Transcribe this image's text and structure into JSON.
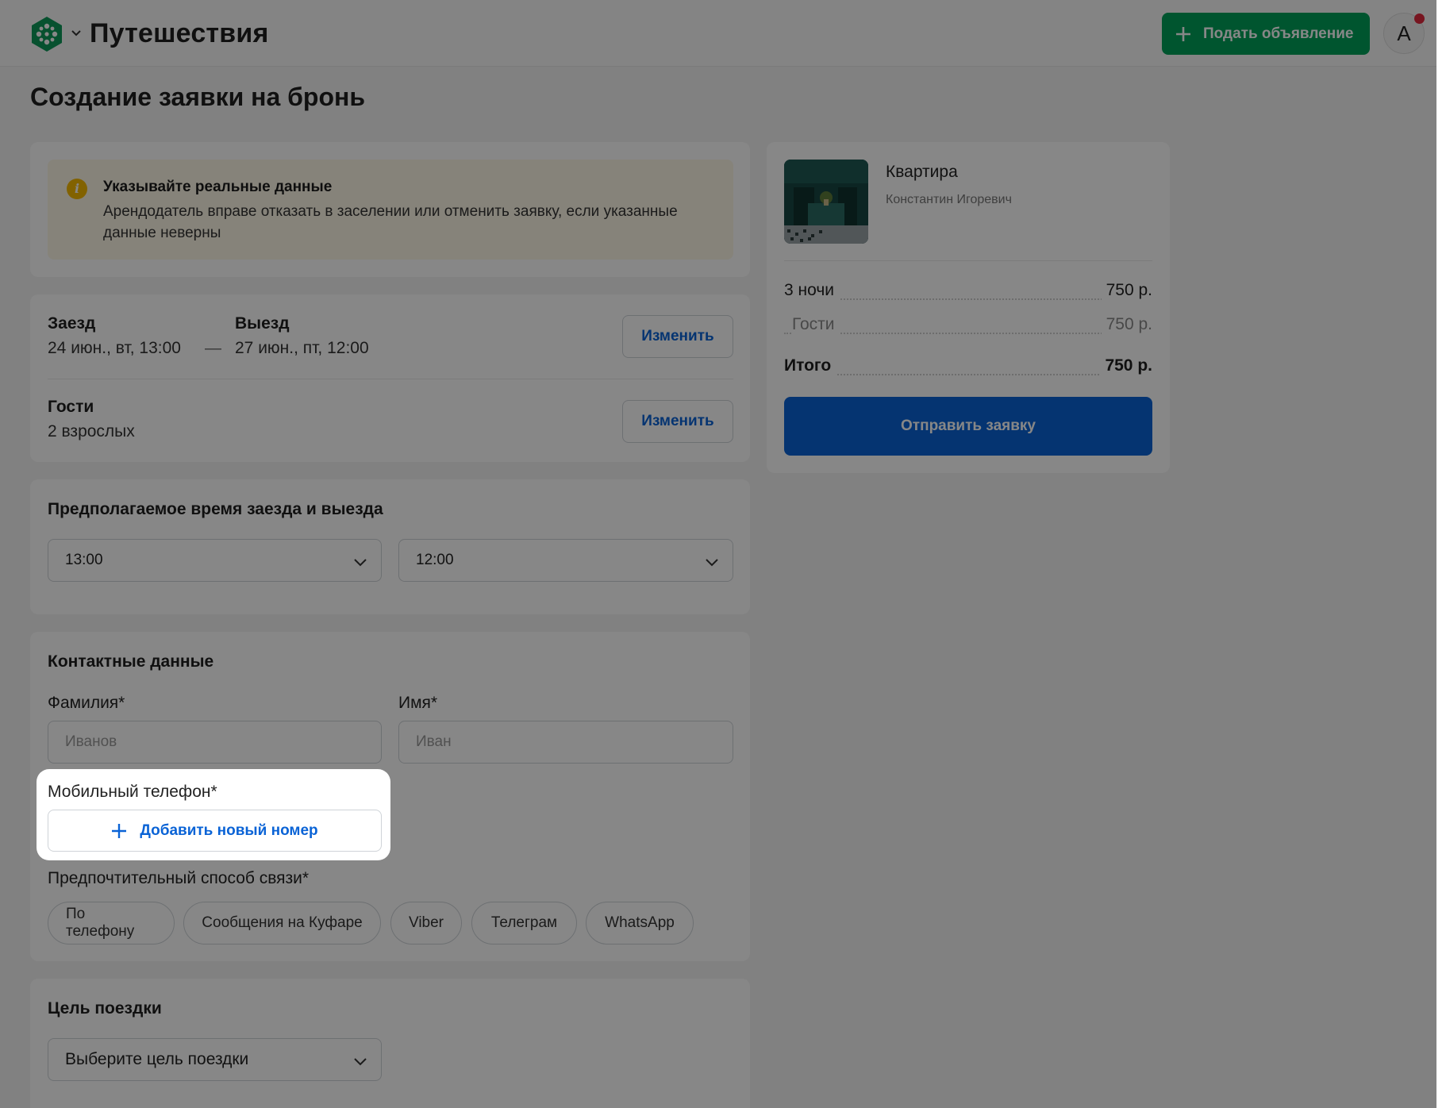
{
  "header": {
    "site_title": "Путешествия",
    "post_button": "Подать объявление",
    "avatar_letter": "А"
  },
  "page_title": "Создание заявки на бронь",
  "notice": {
    "title": "Указывайте реальные данные",
    "text": "Арендодатель вправе отказать в заселении или отменить заявку, если указанные данные неверны"
  },
  "dates": {
    "checkin_label": "Заезд",
    "checkin_value": "24 июн., вт, 13:00",
    "dash": "—",
    "checkout_label": "Выезд",
    "checkout_value": "27 июн., пт, 12:00",
    "change_button": "Изменить"
  },
  "guests": {
    "label": "Гости",
    "value": "2 взрослых",
    "change_button": "Изменить"
  },
  "times": {
    "title": "Предполагаемое время заезда и выезда",
    "checkin_time": "13:00",
    "checkout_time": "12:00"
  },
  "contacts": {
    "title": "Контактные данные",
    "last_name_label": "Фамилия*",
    "last_name_placeholder": "Иванов",
    "first_name_label": "Имя*",
    "first_name_placeholder": "Иван",
    "phone_label": "Мобильный телефон*",
    "add_phone_button": "Добавить новый номер",
    "contact_method_label": "Предпочтительный способ связи*",
    "contact_methods": [
      "По телефону",
      "Сообщения на Куфаре",
      "Viber",
      "Телеграм",
      "WhatsApp"
    ]
  },
  "trip_purpose": {
    "title": "Цель поездки",
    "placeholder": "Выберите цель поездки"
  },
  "summary": {
    "property_type": "Квартира",
    "host_name": "Константин Игоревич",
    "nights_label": "3 ночи",
    "nights_price": "750 р.",
    "guests_label": "Гости",
    "guests_price": "750 р.",
    "total_label": "Итого",
    "total_price": "750 р.",
    "submit_button": "Отправить заявку"
  },
  "colors": {
    "brand_green": "#00a05a",
    "accent_blue": "#0a63d6",
    "notice_bg": "#fdf7e6",
    "notice_icon": "#f6b900",
    "notification_dot": "#e0293d"
  }
}
